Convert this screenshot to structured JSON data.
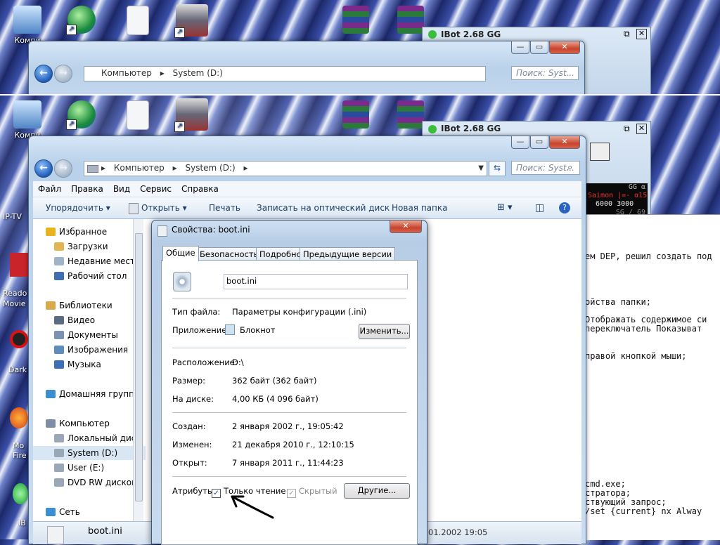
{
  "desktop": {
    "icons": [
      {
        "label": "Компи"
      },
      {
        "label": ""
      },
      {
        "label": ""
      },
      {
        "label": ""
      },
      {
        "label": ""
      },
      {
        "label": ""
      }
    ],
    "left_icons": [
      "IP-TV",
      "Reado Movie",
      "Dark",
      "Mo Fire",
      "IB"
    ]
  },
  "explorer": {
    "address": {
      "parts": [
        "Компьютер",
        "System (D:)"
      ],
      "sep": "▸"
    },
    "search_placeholder": "Поиск: Syst...",
    "menu": [
      "Файл",
      "Правка",
      "Вид",
      "Сервис",
      "Справка"
    ],
    "toolbar": {
      "organize": "Упорядочить ▾",
      "open": "Открыть ▾",
      "print": "Печать",
      "burn": "Записать на оптический диск",
      "new_folder": "Новая папка"
    },
    "nav": [
      {
        "label": "Избранное",
        "level": 0,
        "color": "#e8b31c"
      },
      {
        "label": "Загрузки",
        "level": 1,
        "color": "#e2b552"
      },
      {
        "label": "Недавние места",
        "level": 1,
        "color": "#9fb3c9"
      },
      {
        "label": "Рабочий стол",
        "level": 1,
        "color": "#3f6fb3"
      },
      {
        "label": "Библиотеки",
        "level": 0,
        "color": "#d9a94b"
      },
      {
        "label": "Видео",
        "level": 1,
        "color": "#5b6b82"
      },
      {
        "label": "Документы",
        "level": 1,
        "color": "#7b93b3"
      },
      {
        "label": "Изображения",
        "level": 1,
        "color": "#5d8db8"
      },
      {
        "label": "Музыка",
        "level": 1,
        "color": "#3d6fb8"
      },
      {
        "label": "Домашняя группа",
        "level": 0,
        "color": "#3b8ed0"
      },
      {
        "label": "Компьютер",
        "level": 0,
        "color": "#7d8da4"
      },
      {
        "label": "Локальный диск",
        "level": 1,
        "color": "#9aa7b6"
      },
      {
        "label": "System (D:)",
        "level": 1,
        "color": "#9aa7b6"
      },
      {
        "label": "User (E:)",
        "level": 1,
        "color": "#9aa7b6"
      },
      {
        "label": "DVD RW дисково",
        "level": 1,
        "color": "#9aa7b6"
      },
      {
        "label": "Сеть",
        "level": 0,
        "color": "#3b8ed0"
      }
    ],
    "status": {
      "filename": "boot.ini",
      "date": "01.2002 19:05"
    }
  },
  "ibot": {
    "title": "IBot 2.68 GG",
    "stats": [
      "GG α",
      "Saimon |=- α15",
      "6000 3000",
      "SG / 69"
    ]
  },
  "editor": {
    "lines": [
      "ем DEP, решил создать под",
      "ойства папки;",
      "Отображать содержимое си",
      "переключатель Показыват",
      "правой кнопкой мыши;",
      "cmd.exe;",
      "стратора;",
      "ствующий запрос;",
      "/set {current} nx Alway"
    ]
  },
  "dialog": {
    "title": "Свойства: boot.ini",
    "tabs": [
      "Общие",
      "Безопасность",
      "Подробно",
      "Предыдущие версии"
    ],
    "filename": "boot.ini",
    "file_type_label": "Тип файла:",
    "file_type": "Параметры конфигурации (.ini)",
    "app_label": "Приложение:",
    "app": "Блокнот",
    "change_btn": "Изменить...",
    "location_label": "Расположение:",
    "location": "D:\\",
    "size_label": "Размер:",
    "size": "362 байт (362 байт)",
    "disk_label": "На диске:",
    "disk": "4,00 КБ (4 096 байт)",
    "created_label": "Создан:",
    "created": "2 января 2002 г., 19:05:42",
    "modified_label": "Изменен:",
    "modified": "21 декабря 2010 г., 12:10:15",
    "opened_label": "Открыт:",
    "opened": "7 января 2011 г., 11:44:23",
    "attrs_label": "Атрибуты:",
    "readonly": "Только чтение",
    "hidden": "Скрытый",
    "other_btn": "Другие...",
    "close_glyph": "✕"
  }
}
